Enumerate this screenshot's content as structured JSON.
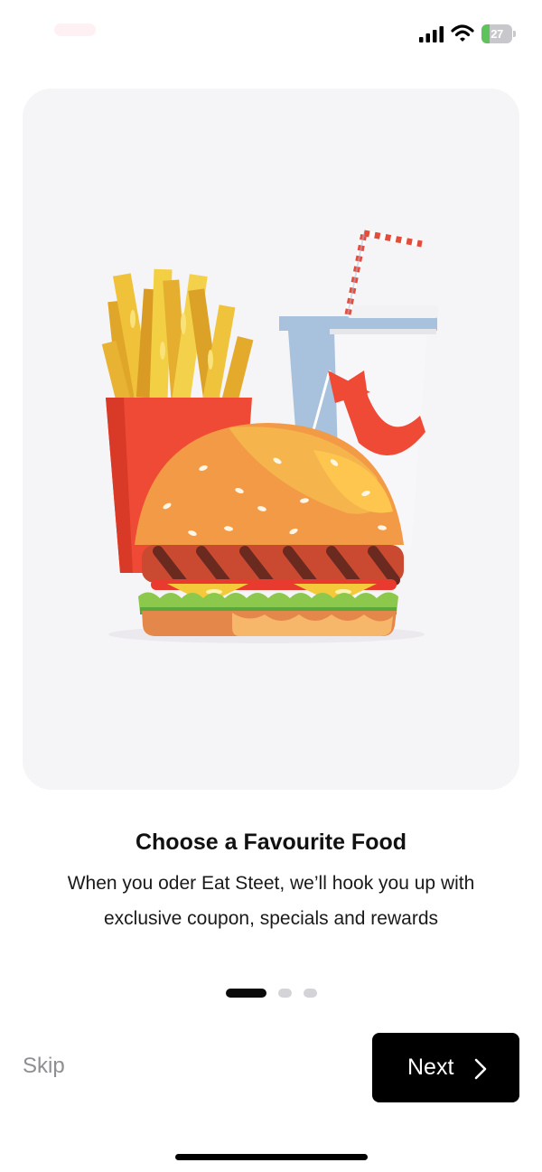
{
  "status_bar": {
    "battery_level": "27",
    "battery_fraction": 0.27,
    "battery_color": "#5dc35a"
  },
  "hero": {
    "icons": [
      "french-fries-icon",
      "soda-cup-icon",
      "burger-icon"
    ]
  },
  "onboarding": {
    "title": "Choose a Favourite Food",
    "description_line1": "When you oder Eat Steet, we’ll hook you up with",
    "description_line2": "exclusive coupon, specials and rewards"
  },
  "pagination": {
    "total": 3,
    "current": 1,
    "active_color": "#0b0b0b",
    "inactive_color": "#d4d4d8"
  },
  "actions": {
    "skip_label": "Skip",
    "next_label": "Next",
    "next_icon": "chevron-right-icon"
  }
}
